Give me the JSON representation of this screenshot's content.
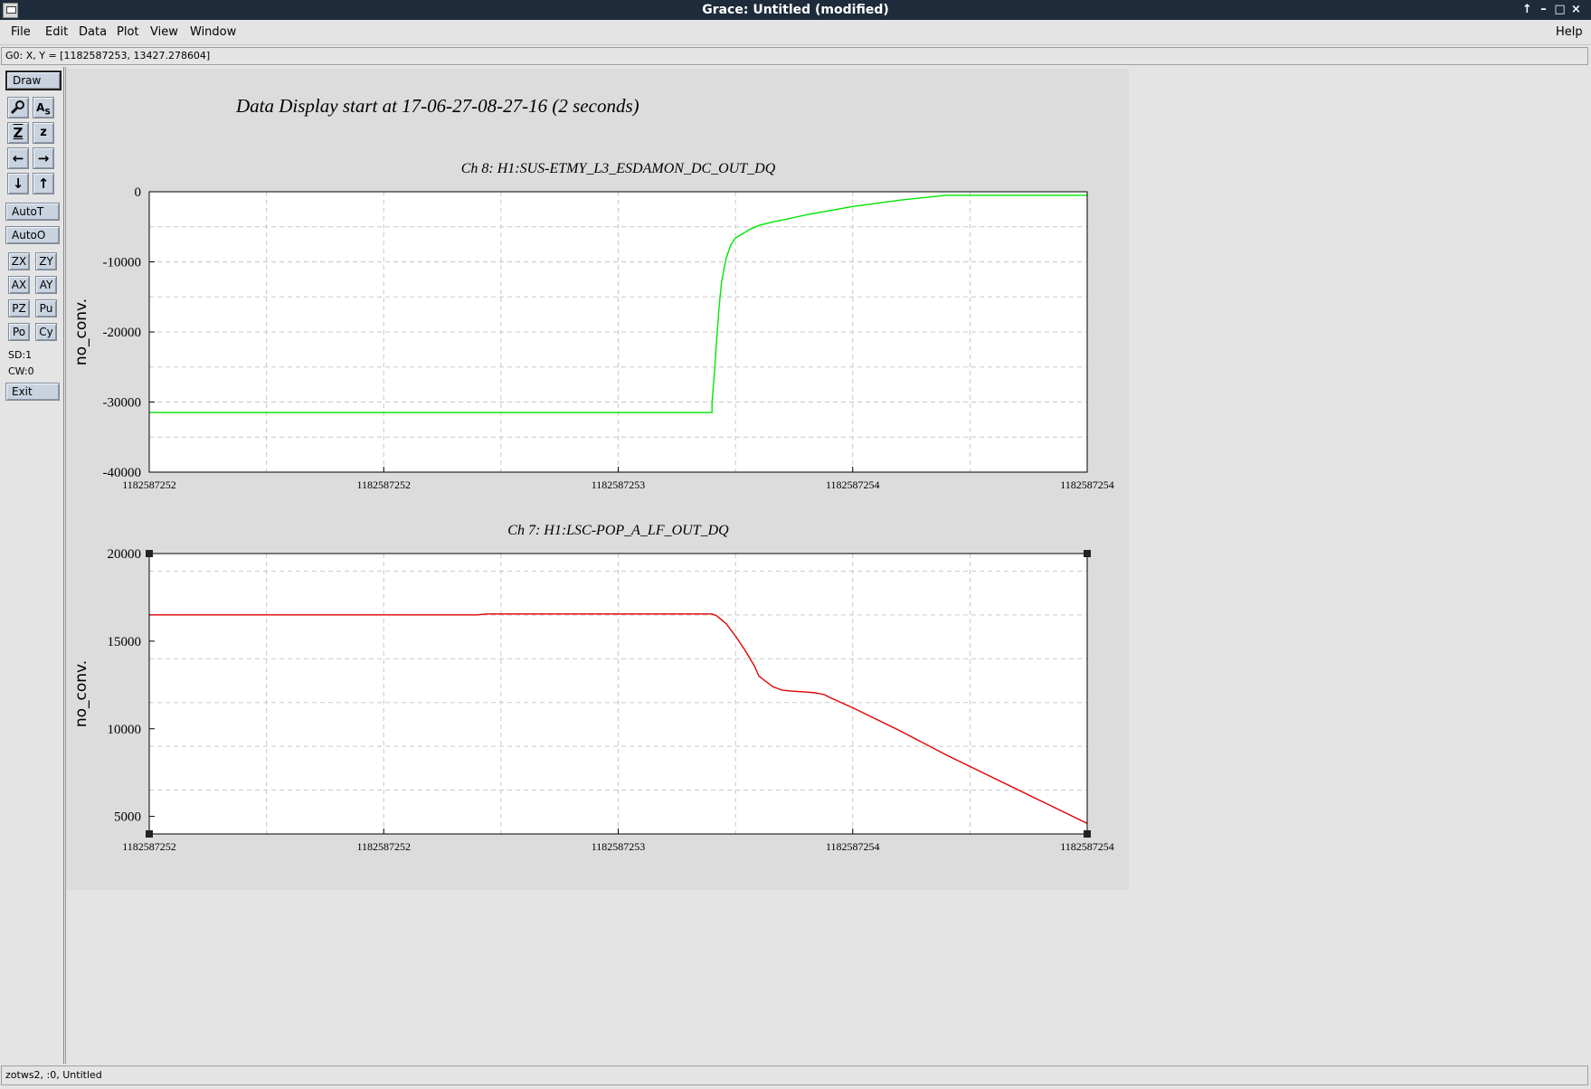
{
  "window": {
    "title": "Grace: Untitled (modified)",
    "buttons": [
      "↑",
      "–",
      "□",
      "×"
    ]
  },
  "menubar": {
    "file": "File",
    "edit": "Edit",
    "data": "Data",
    "plot": "Plot",
    "view": "View",
    "window": "Window",
    "help": "Help"
  },
  "locator": "G0: X, Y = [1182587253, 13427.278604]",
  "toolbar": {
    "draw": "Draw",
    "icons": [
      "zoom-icon",
      "text-style-icon",
      "autoscale-zoom-icon",
      "autoscale-z-icon",
      "arrow-left-icon",
      "arrow-right-icon",
      "arrow-down-icon",
      "arrow-up-icon"
    ],
    "autot": "AutoT",
    "autoo": "AutoO",
    "zx": "ZX",
    "zy": "ZY",
    "ax": "AX",
    "ay": "AY",
    "pz": "PZ",
    "pu": "Pu",
    "po": "Po",
    "cy": "Cy",
    "sd": "SD:1",
    "cw": "CW:0",
    "exit": "Exit"
  },
  "page_title": "Data Display start at 17-06-27-08-27-16 (2 seconds)",
  "statusbar": "zotws2, :0, Untitled",
  "chart_data": [
    {
      "type": "line",
      "title": "Ch 8: H1:SUS-ETMY_L3_ESDAMON_DC_OUT_DQ",
      "xlabel": "",
      "ylabel": "no_conv.",
      "xlim": [
        0,
        2
      ],
      "ylim": [
        -40000,
        0
      ],
      "xticks": [
        0,
        0.5,
        1,
        1.5,
        2
      ],
      "xtick_labels": [
        "1182587252",
        "1182587252",
        "1182587253",
        "1182587254",
        "1182587254"
      ],
      "yticks": [
        0,
        -10000,
        -20000,
        -30000,
        -40000
      ],
      "ytick_labels": [
        "0",
        "-10000",
        "-20000",
        "-30000",
        "-40000"
      ],
      "grid": true,
      "color": "#00e600",
      "series": [
        {
          "x": [
            0,
            0.5,
            1.0,
            1.2,
            1.2,
            1.205,
            1.21,
            1.215,
            1.22,
            1.23,
            1.24,
            1.25,
            1.26,
            1.28,
            1.3,
            1.33,
            1.36,
            1.4,
            1.5,
            1.6,
            1.7,
            1.8,
            1.9,
            2.0
          ],
          "y": [
            -31500,
            -31500,
            -31500,
            -31500,
            -30000,
            -26000,
            -21000,
            -16500,
            -13000,
            -9500,
            -7600,
            -6600,
            -6200,
            -5400,
            -4800,
            -4300,
            -3900,
            -3300,
            -2100,
            -1200,
            -500,
            -500,
            -500,
            -500
          ]
        }
      ]
    },
    {
      "type": "line",
      "title": "Ch 7: H1:LSC-POP_A_LF_OUT_DQ",
      "xlabel": "",
      "ylabel": "no_conv.",
      "xlim": [
        0,
        2
      ],
      "ylim": [
        4000,
        20000
      ],
      "xticks": [
        0,
        0.5,
        1,
        1.5,
        2
      ],
      "xtick_labels": [
        "1182587252",
        "1182587252",
        "1182587253",
        "1182587254",
        "1182587254"
      ],
      "yticks": [
        20000,
        15000,
        10000,
        5000
      ],
      "ytick_labels": [
        "20000",
        "15000",
        "10000",
        "5000"
      ],
      "grid": true,
      "color": "#e00000",
      "series": [
        {
          "x": [
            0,
            0.7,
            0.72,
            1.0,
            1.2,
            1.21,
            1.23,
            1.25,
            1.27,
            1.29,
            1.3,
            1.31,
            1.33,
            1.35,
            1.37,
            1.4,
            1.42,
            1.44,
            1.45,
            1.5,
            1.6,
            1.7,
            1.8,
            1.9,
            2.0
          ],
          "y": [
            16500,
            16500,
            16550,
            16550,
            16550,
            16450,
            16000,
            15300,
            14500,
            13600,
            13000,
            12800,
            12400,
            12200,
            12150,
            12100,
            12050,
            11950,
            11800,
            11200,
            9900,
            8500,
            7200,
            5900,
            4600
          ]
        }
      ]
    }
  ]
}
